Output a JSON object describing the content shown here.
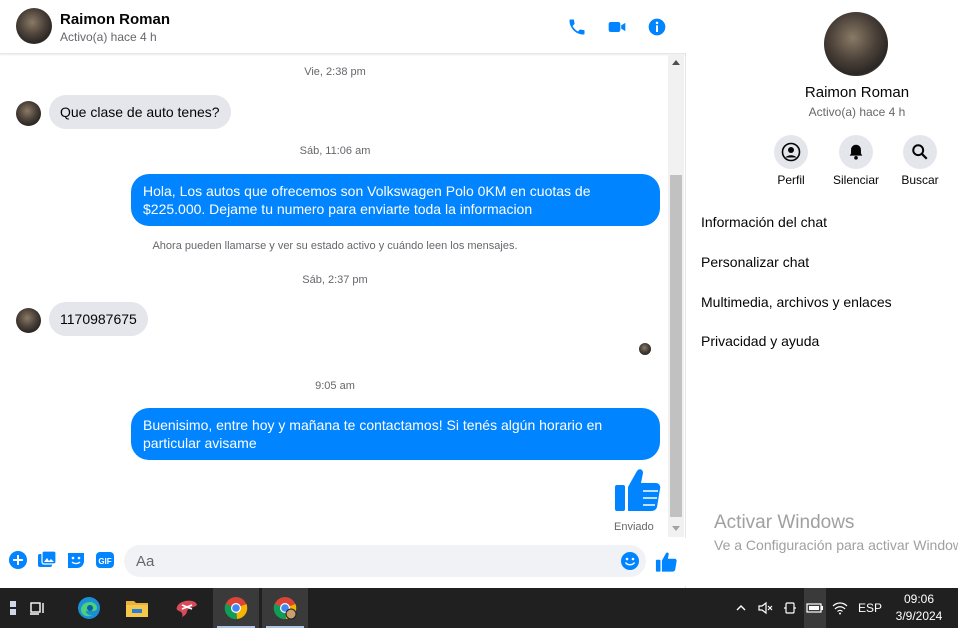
{
  "contact": {
    "name": "Raimon Roman",
    "status": "Activo(a) hace 4 h"
  },
  "header": {
    "call_icon": "phone-icon",
    "video_icon": "video-icon",
    "info_icon": "info-icon"
  },
  "messages": {
    "ts1": "Vie, 2:38 pm",
    "msg1": "Que clase de auto tenes?",
    "ts2": "Sáb, 11:06 am",
    "msg2": "Hola, Los autos que ofrecemos son Volkswagen Polo 0KM en cuotas de $225.000. Dejame tu numero para enviarte toda la informacion",
    "notice": "Ahora pueden llamarse y ver su estado activo y cuándo leen los mensajes.",
    "ts3": "Sáb, 2:37 pm",
    "msg3": "1170987675",
    "ts4": "9:05 am",
    "msg4": "Buenisimo, entre hoy y mañana te contactamos! Si tenés algún horario en particular avisame",
    "sent_label": "Enviado"
  },
  "composer": {
    "placeholder": "Aa",
    "gif_label": "GIF"
  },
  "info_panel": {
    "name": "Raimon Roman",
    "status": "Activo(a) hace 4 h",
    "actions": [
      {
        "label": "Perfil",
        "icon": "profile-icon"
      },
      {
        "label": "Silenciar",
        "icon": "bell-icon"
      },
      {
        "label": "Buscar",
        "icon": "search-icon"
      }
    ],
    "menu": [
      "Información del chat",
      "Personalizar chat",
      "Multimedia, archivos y enlaces",
      "Privacidad y ayuda"
    ],
    "watermark_title": "Activar Windows",
    "watermark_sub": "Ve a Configuración para activar Windows."
  },
  "taskbar": {
    "lang": "ESP",
    "time": "09:06",
    "date": "3/9/2024"
  },
  "colors": {
    "accent": "#0084ff",
    "bubble_in": "#e4e6eb",
    "taskbar": "#202020"
  }
}
